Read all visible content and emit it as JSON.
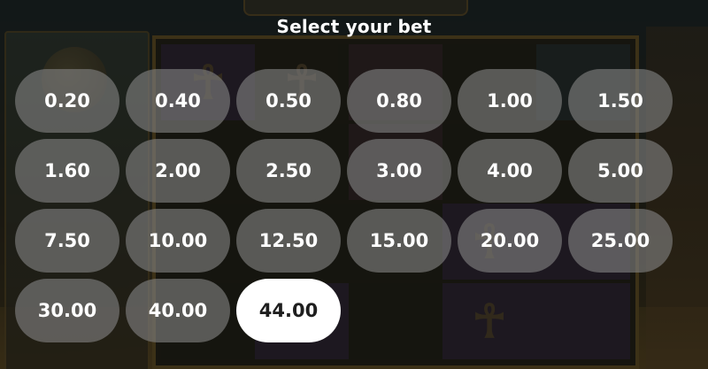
{
  "title": "Select your bet",
  "selected_bet": "44.00",
  "colors": {
    "button_bg": "#828282",
    "button_text": "#ffffff",
    "selected_bg": "#ffffff",
    "selected_text": "#1e1e1e"
  },
  "bets": [
    {
      "label": "0.20"
    },
    {
      "label": "0.40"
    },
    {
      "label": "0.50"
    },
    {
      "label": "0.80"
    },
    {
      "label": "1.00"
    },
    {
      "label": "1.50"
    },
    {
      "label": "1.60"
    },
    {
      "label": "2.00"
    },
    {
      "label": "2.50"
    },
    {
      "label": "3.00"
    },
    {
      "label": "4.00"
    },
    {
      "label": "5.00"
    },
    {
      "label": "7.50"
    },
    {
      "label": "10.00"
    },
    {
      "label": "12.50"
    },
    {
      "label": "15.00"
    },
    {
      "label": "20.00"
    },
    {
      "label": "25.00"
    },
    {
      "label": "30.00"
    },
    {
      "label": "40.00"
    },
    {
      "label": "44.00"
    }
  ]
}
